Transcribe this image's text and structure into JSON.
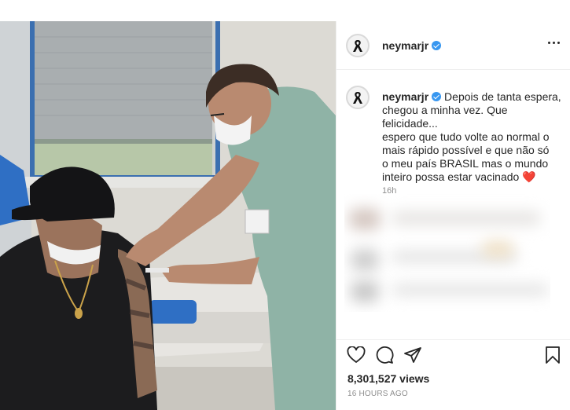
{
  "post": {
    "username": "neymarjr",
    "verified": true,
    "caption_lines": [
      "Depois de tanta espera,",
      "chegou a minha vez. Que",
      "felicidade...",
      "espero que tudo volte ao normal o",
      "mais rápido possível e que não só",
      "o meu país BRASIL mas o mundo",
      "inteiro possa estar vacinado"
    ],
    "caption_emoji": "❤️",
    "comment_time": "16h",
    "views": "8,301,527 views",
    "posted_ago": "16 HOURS AGO"
  },
  "icons": {
    "avatar": "black-ribbon-icon",
    "verified": "verified-badge-icon",
    "more": "more-options-icon",
    "like": "heart-icon",
    "comment": "comment-icon",
    "share": "paper-plane-icon",
    "save": "bookmark-icon"
  },
  "colors": {
    "verified_blue": "#3897f0",
    "text": "#262626",
    "muted": "#8e8e8e",
    "divider": "#efefef",
    "heart_emoji": "#e0245e"
  }
}
